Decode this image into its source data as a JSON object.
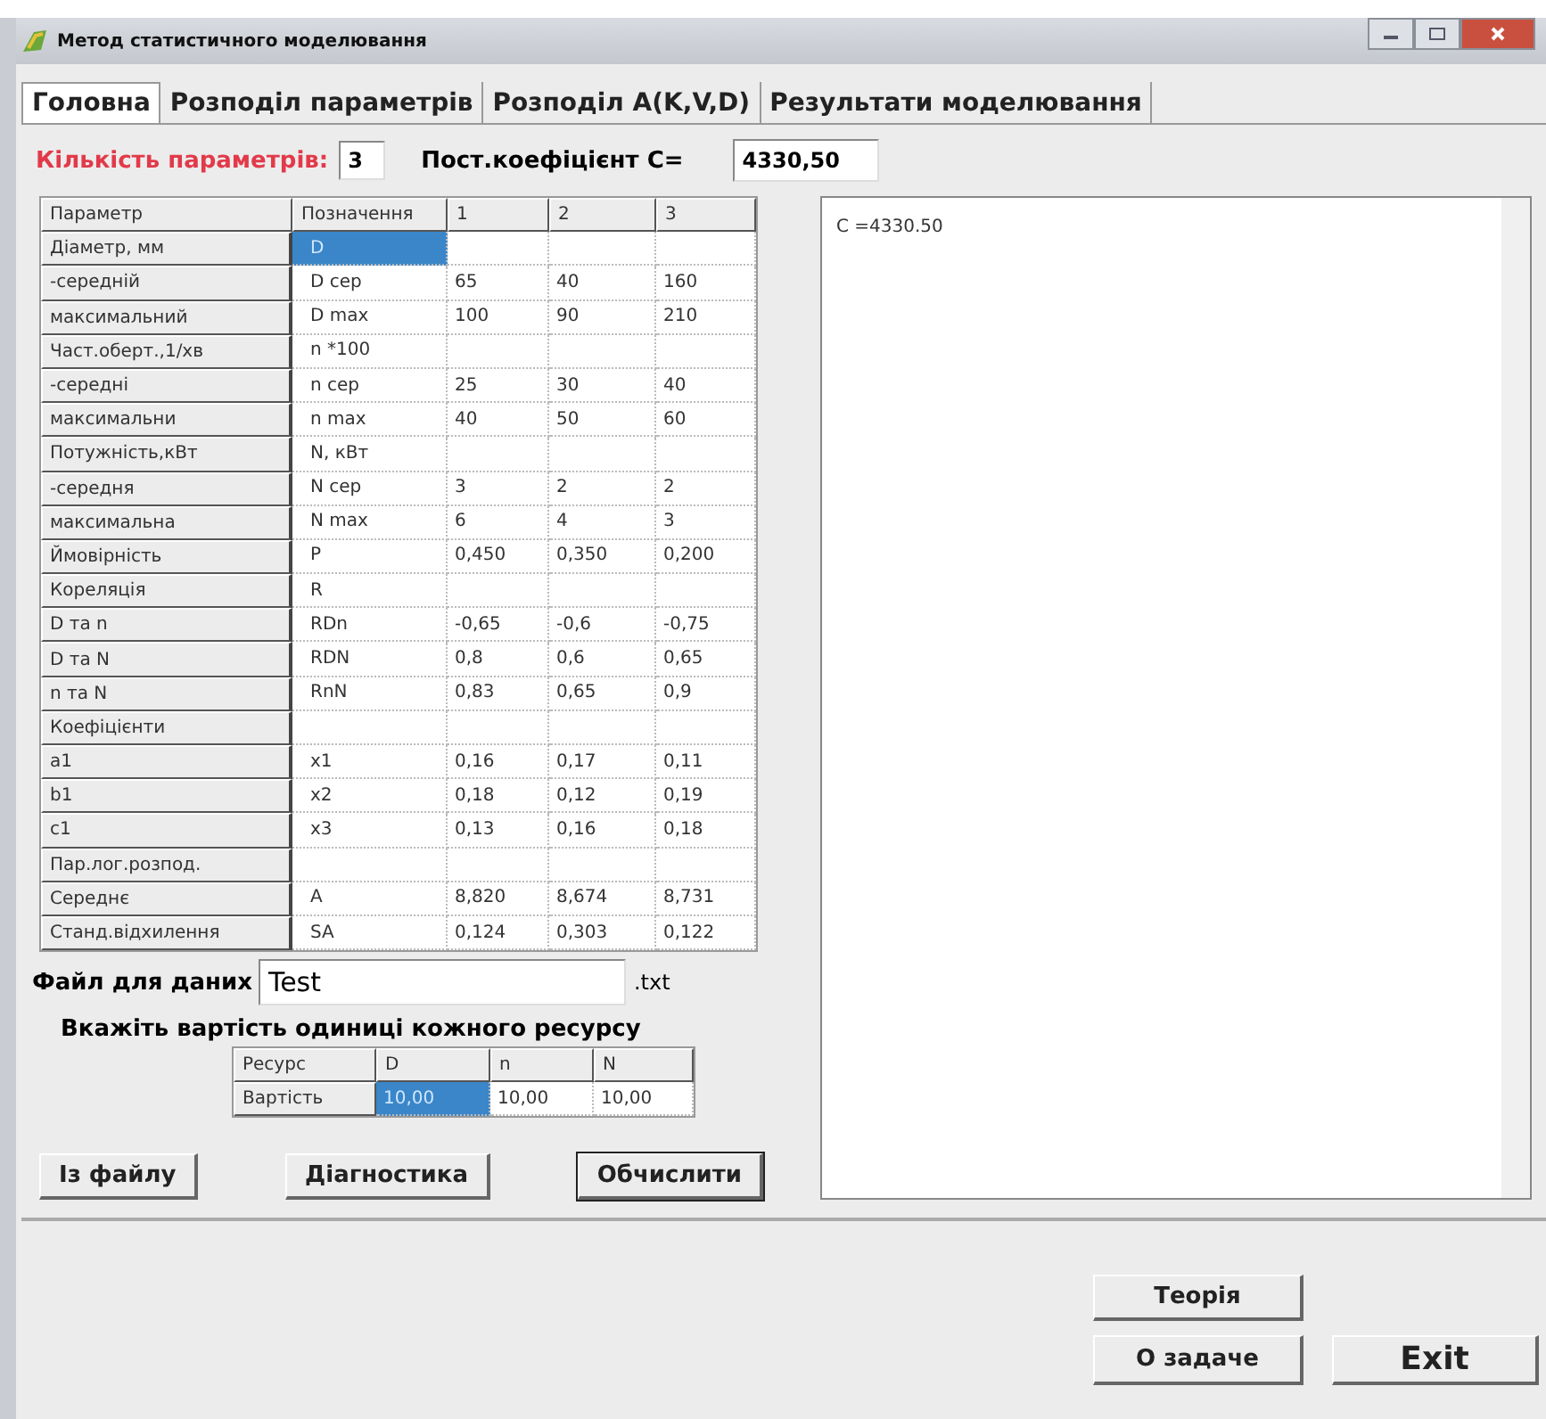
{
  "window": {
    "title": "Метод статистичного моделювання"
  },
  "tabs": [
    {
      "label": "Головна",
      "selected": true
    },
    {
      "label": "Розподіл параметрів",
      "selected": false
    },
    {
      "label": "Розподіл A(K,V,D)",
      "selected": false
    },
    {
      "label": "Результати моделювання",
      "selected": false
    }
  ],
  "params": {
    "count_label": "Кількість параметрів:",
    "count_value": "3",
    "coef_label": "Пост.коефіцієнт С=",
    "coef_value": "4330,50"
  },
  "table": {
    "columns": [
      "Параметр",
      "Позначення",
      "1",
      "2",
      "3"
    ],
    "rows": [
      {
        "label": "Діаметр, мм",
        "symbol": "D",
        "values": [],
        "selected": true
      },
      {
        "label": "-середній",
        "symbol": "D сер",
        "values": [
          "65",
          "40",
          "160"
        ],
        "selected": false
      },
      {
        "label": "максимальний",
        "symbol": "D max",
        "values": [
          "100",
          "90",
          "210"
        ],
        "selected": false
      },
      {
        "label": "Част.оберт.,1/хв",
        "symbol": "n *100",
        "values": [],
        "selected": false
      },
      {
        "label": "-середні",
        "symbol": "n сер",
        "values": [
          "25",
          "30",
          "40"
        ],
        "selected": false
      },
      {
        "label": "максимальни",
        "symbol": "n max",
        "values": [
          "40",
          "50",
          "60"
        ],
        "selected": false
      },
      {
        "label": "Потужність,кВт",
        "symbol": "N, кВт",
        "values": [],
        "selected": false
      },
      {
        "label": "-середня",
        "symbol": "N сер",
        "values": [
          "3",
          "2",
          "2"
        ],
        "selected": false
      },
      {
        "label": "максимальна",
        "symbol": "N max",
        "values": [
          "6",
          "4",
          "3"
        ],
        "selected": false
      },
      {
        "label": "Ймовірність",
        "symbol": "P",
        "values": [
          "0,450",
          "0,350",
          "0,200"
        ],
        "selected": false
      },
      {
        "label": "Кореляція",
        "symbol": "R",
        "values": [],
        "selected": false
      },
      {
        "label": "D та n",
        "symbol": "RDn",
        "values": [
          "-0,65",
          "-0,6",
          "-0,75"
        ],
        "selected": false
      },
      {
        "label": "D та N",
        "symbol": "RDN",
        "values": [
          "0,8",
          "0,6",
          "0,65"
        ],
        "selected": false
      },
      {
        "label": "n та N",
        "symbol": "RnN",
        "values": [
          "0,83",
          "0,65",
          "0,9"
        ],
        "selected": false
      },
      {
        "label": "Коефіцієнти",
        "values": [],
        "selected": false
      },
      {
        "label": "a1",
        "symbol": "x1",
        "values": [
          "0,16",
          "0,17",
          "0,11"
        ],
        "selected": false
      },
      {
        "label": "b1",
        "symbol": "x2",
        "values": [
          "0,18",
          "0,12",
          "0,19"
        ],
        "selected": false
      },
      {
        "label": "c1",
        "symbol": "x3",
        "values": [
          "0,13",
          "0,16",
          "0,18"
        ],
        "selected": false
      },
      {
        "label": "Пар.лог.розпод.",
        "values": [],
        "selected": false
      },
      {
        "label": "Середнє",
        "symbol": "A",
        "values": [
          "8,820",
          "8,674",
          "8,731"
        ],
        "selected": false
      },
      {
        "label": "Станд.відхилення",
        "symbol": "SA",
        "values": [
          "0,124",
          "0,303",
          "0,122"
        ],
        "selected": false
      }
    ]
  },
  "file": {
    "label": "Файл для даних",
    "value": "Test",
    "extension": ".txt"
  },
  "cost": {
    "title": "Вкажіть вартість одиниці кожного ресурсу",
    "columns": [
      "Ресурс",
      "D",
      "n",
      "N"
    ],
    "row_label": "Вартість",
    "values": [
      {
        "text": "10,00",
        "selected": true
      },
      {
        "text": "10,00",
        "selected": false
      },
      {
        "text": "10,00",
        "selected": false
      }
    ]
  },
  "buttons": [
    "Із файлу",
    "Діагностика",
    "Обчислити"
  ],
  "output": {
    "text": "C =4330.50"
  },
  "footer_buttons": {
    "theory": "Теорія",
    "about": "О задаче",
    "exit": "Exit"
  }
}
